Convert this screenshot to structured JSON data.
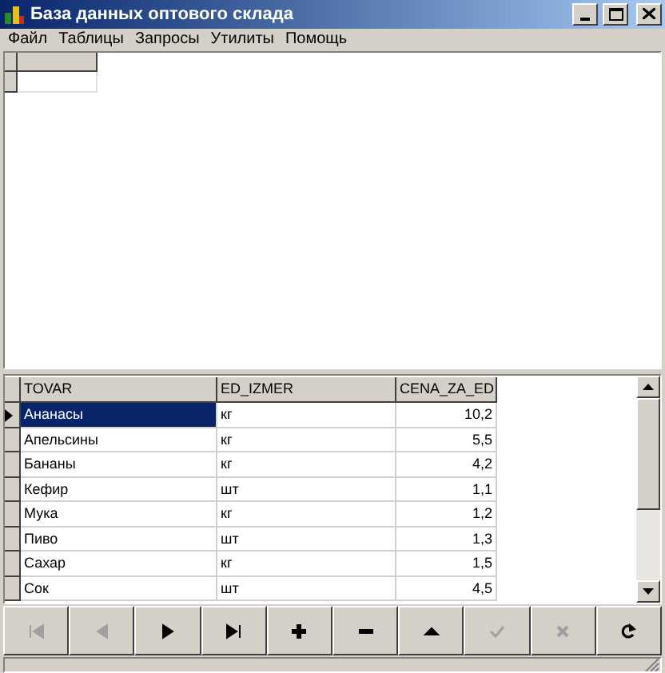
{
  "window": {
    "title": "База данных оптового склада"
  },
  "menu": [
    "Файл",
    "Таблицы",
    "Запросы",
    "Утилиты",
    "Помощь"
  ],
  "table": {
    "columns": [
      "TOVAR",
      "ED_IZMER",
      "CENA_ZA_ED"
    ],
    "rows": [
      {
        "cells": [
          "Ананасы",
          "кг",
          "10,2"
        ],
        "selected": true
      },
      {
        "cells": [
          "Апельсины",
          "кг",
          "5,5"
        ],
        "selected": false
      },
      {
        "cells": [
          "Бананы",
          "кг",
          "4,2"
        ],
        "selected": false
      },
      {
        "cells": [
          "Кефир",
          "шт",
          "1,1"
        ],
        "selected": false
      },
      {
        "cells": [
          "Мука",
          "кг",
          "1,2"
        ],
        "selected": false
      },
      {
        "cells": [
          "Пиво",
          "шт",
          "1,3"
        ],
        "selected": false
      },
      {
        "cells": [
          "Сахар",
          "кг",
          "1,5"
        ],
        "selected": false
      },
      {
        "cells": [
          "Сок",
          "шт",
          "4,5"
        ],
        "selected": false
      }
    ]
  },
  "navigator": [
    {
      "kind": "first",
      "disabled": true
    },
    {
      "kind": "prior",
      "disabled": true
    },
    {
      "kind": "next",
      "disabled": false
    },
    {
      "kind": "last",
      "disabled": false
    },
    {
      "kind": "insert",
      "disabled": false
    },
    {
      "kind": "delete",
      "disabled": false
    },
    {
      "kind": "edit",
      "disabled": false
    },
    {
      "kind": "post",
      "disabled": true
    },
    {
      "kind": "cancel",
      "disabled": true
    },
    {
      "kind": "refresh",
      "disabled": false
    }
  ]
}
